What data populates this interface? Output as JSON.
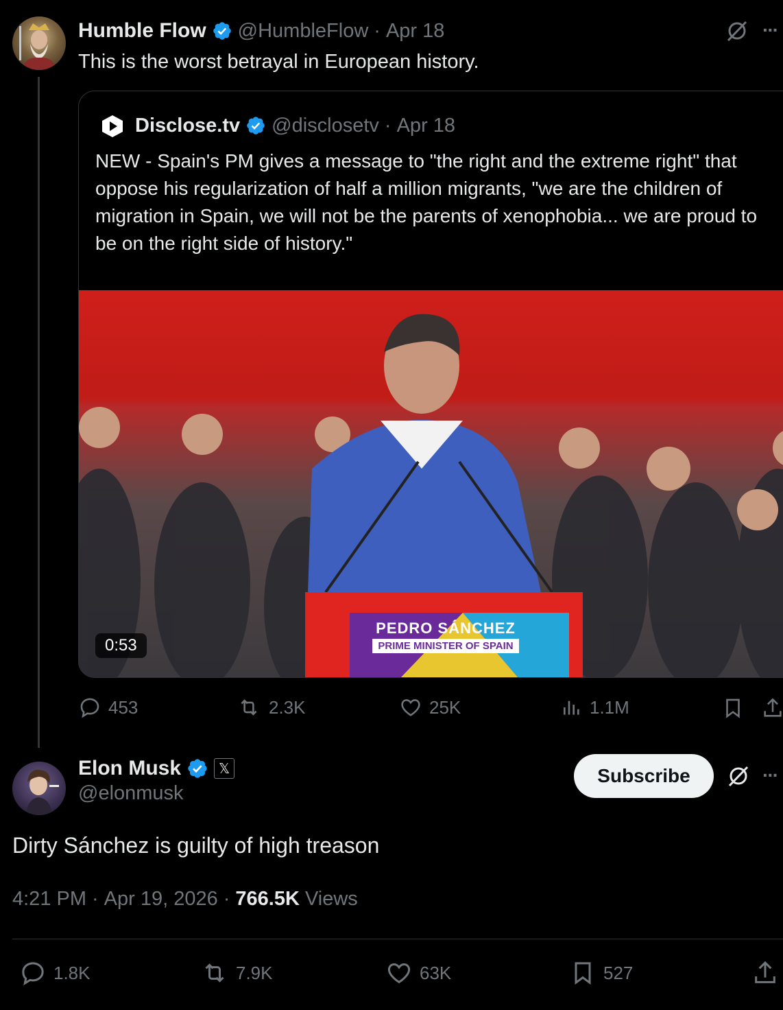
{
  "parent_tweet": {
    "author_name": "Humble Flow",
    "handle": "@HumbleFlow",
    "sep": "·",
    "date": "Apr 18",
    "text": "This is the worst betrayal in European history.",
    "quoted": {
      "author_name": "Disclose.tv",
      "handle": "@disclosetv",
      "sep": "·",
      "date": "Apr 18",
      "text": "NEW - Spain's PM gives a message to \"the right and the extreme right\" that oppose his regularization of half a million migrants, \"we are the children of migration in Spain, we will not be the parents of xenophobia... we are proud to be on the right side of history.\"",
      "video_duration": "0:53",
      "video_lower_third_name": "PEDRO SÁNCHEZ",
      "video_lower_third_title": "PRIME MINISTER OF SPAIN"
    },
    "metrics": {
      "replies": "453",
      "reposts": "2.3K",
      "likes": "25K",
      "views": "1.1M"
    }
  },
  "main_tweet": {
    "author_name": "Elon Musk",
    "handle": "@elonmusk",
    "affiliate_badge": "𝕏",
    "subscribe_label": "Subscribe",
    "more": "···",
    "text": "Dirty Sánchez is guilty of high treason",
    "time": "4:21 PM",
    "sep1": "·",
    "date": "Apr 19, 2026",
    "sep2": "·",
    "views_count": "766.5K",
    "views_label": "Views",
    "metrics": {
      "replies": "1.8K",
      "reposts": "7.9K",
      "likes": "63K",
      "bookmarks": "527"
    }
  },
  "top_more": "···",
  "colors": {
    "background": "#000000",
    "text": "#e7e9ea",
    "muted": "#71767b",
    "verified": "#1d9bf0",
    "border": "#2f3336"
  }
}
